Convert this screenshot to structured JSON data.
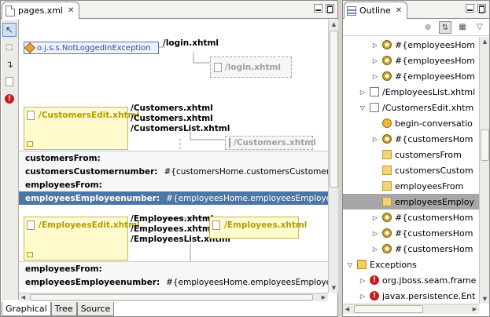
{
  "editor": {
    "tab_title": "pages.xml",
    "bottom_tabs": [
      "Graphical",
      "Tree",
      "Source"
    ],
    "palette_tools": [
      "select-tool",
      "marquee-tool",
      "connection-tool",
      "page-tool",
      "exception-tool"
    ]
  },
  "diagram": {
    "exception_label": "o.j.s.s.NotLoggedInException",
    "exception_target": "/login.xhtml",
    "login_ghost": "/login.xhtml",
    "customers_edit": {
      "title": "/CustomersEdit.xhtml",
      "links": [
        "/Customers.xhtml",
        "/Customers.xhtml",
        "/CustomersList.xhtml"
      ],
      "ghost": "/Customers.xhtml",
      "params": [
        {
          "name": "customersFrom:",
          "value": ""
        },
        {
          "name": "customersCustomernumber:",
          "value": "#{customersHome.customersCustomernumber}"
        },
        {
          "name": "employeesFrom:",
          "value": ""
        },
        {
          "name": "employeesEmployeenumber:",
          "value": "#{employeesHome.employeesEmployeenumber}"
        }
      ]
    },
    "employees_edit": {
      "title": "/EmployeesEdit.xhtml",
      "links": [
        "/Employees.xhtml",
        "/Employees.xhtml",
        "/EmployeesList.xhtml"
      ],
      "target": "/Employees.xhtml",
      "params": [
        {
          "name": "employeesFrom:",
          "value": ""
        },
        {
          "name": "employeesEmployeenumber:",
          "value": "#{employeesHome.employeesEmployeenumber}"
        }
      ]
    }
  },
  "outline": {
    "tab_title": "Outline",
    "rows": [
      {
        "indent": 2,
        "twisty": "▷",
        "icon": "gear",
        "label": "#{employeesHom"
      },
      {
        "indent": 2,
        "twisty": "▷",
        "icon": "gear",
        "label": "#{employeesHom"
      },
      {
        "indent": 2,
        "twisty": "▷",
        "icon": "gear",
        "label": "#{employeesHom"
      },
      {
        "indent": 1,
        "twisty": "▷",
        "icon": "doc",
        "label": "/EmployeesList.xhtml"
      },
      {
        "indent": 1,
        "twisty": "▽",
        "icon": "doc",
        "label": "/CustomersEdit.xhtm"
      },
      {
        "indent": 2,
        "twisty": "",
        "icon": "beginconv",
        "label": "begin-conversatio"
      },
      {
        "indent": 2,
        "twisty": "▷",
        "icon": "gear",
        "label": "#{customersHom"
      },
      {
        "indent": 2,
        "twisty": "",
        "icon": "box",
        "label": "customersFrom"
      },
      {
        "indent": 2,
        "twisty": "",
        "icon": "box",
        "label": "customersCustom"
      },
      {
        "indent": 2,
        "twisty": "",
        "icon": "box",
        "label": "employeesFrom"
      },
      {
        "indent": 2,
        "twisty": "",
        "icon": "box",
        "label": "employeesEmploy"
      },
      {
        "indent": 2,
        "twisty": "▷",
        "icon": "gear",
        "label": "#{customersHom"
      },
      {
        "indent": 2,
        "twisty": "▷",
        "icon": "gear",
        "label": "#{customersHom"
      },
      {
        "indent": 2,
        "twisty": "▷",
        "icon": "gear",
        "label": "#{customersHom"
      },
      {
        "indent": 0,
        "twisty": "▽",
        "icon": "folder",
        "label": "Exceptions"
      },
      {
        "indent": 1,
        "twisty": "▷",
        "icon": "err",
        "label": "org.jboss.seam.frame"
      },
      {
        "indent": 1,
        "twisty": "▷",
        "icon": "err",
        "label": "javax.persistence.Ent"
      }
    ],
    "selected_index": 10
  }
}
